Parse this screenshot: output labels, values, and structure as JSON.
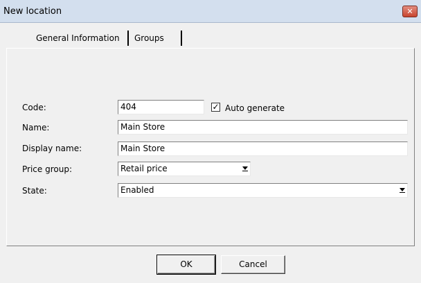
{
  "window": {
    "title": "New location",
    "close_glyph": "✕"
  },
  "tabs": [
    {
      "label": "General Information"
    },
    {
      "label": "Groups"
    }
  ],
  "form": {
    "code_label": "Code:",
    "code_value": "404",
    "auto_generate_label": "Auto generate",
    "auto_generate_checked": true,
    "name_label": "Name:",
    "name_value": "Main Store",
    "display_name_label": "Display name:",
    "display_name_value": "Main Store",
    "price_group_label": "Price group:",
    "price_group_value": "Retail price",
    "state_label": "State:",
    "state_value": "Enabled"
  },
  "buttons": {
    "ok_label": "OK",
    "cancel_label": "Cancel"
  },
  "colors": {
    "titlebar": "#d3dfee",
    "dialog_bg": "#f0f0f0",
    "close_button": "#c8452f"
  }
}
